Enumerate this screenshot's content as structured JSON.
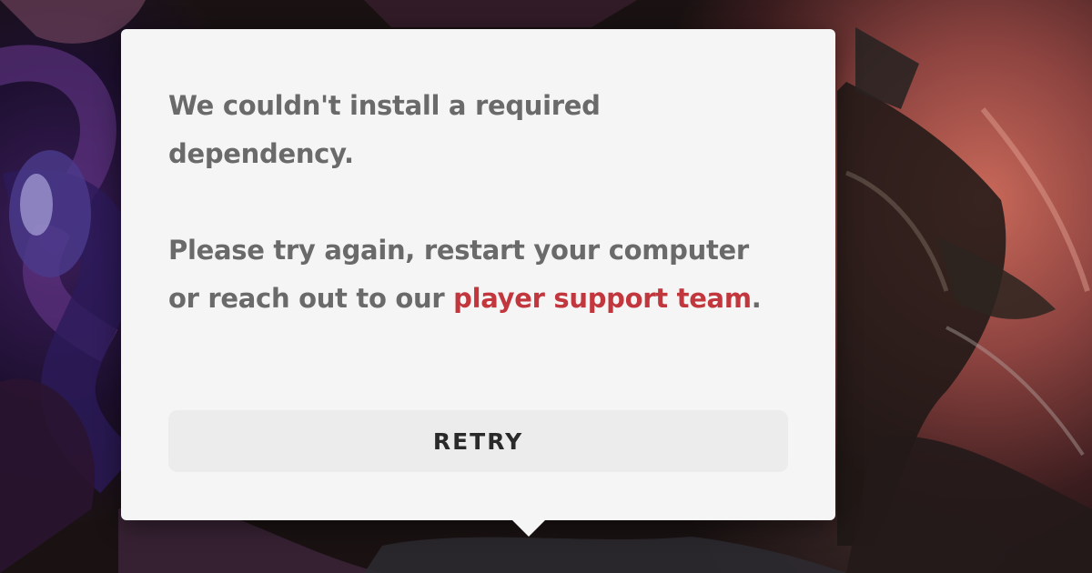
{
  "dialog": {
    "message_line_1": "We couldn't install a required dependency.",
    "message_line_2_prefix": "Please try again, restart your computer or reach out to our ",
    "support_link_text": "player support team",
    "message_line_2_suffix": ".",
    "retry_label": "RETRY"
  },
  "colors": {
    "dialog_background": "#f5f5f5",
    "text": "#6a6a6a",
    "link": "#c2373d",
    "button_background": "#ececec",
    "button_text": "#2a2a2a"
  }
}
